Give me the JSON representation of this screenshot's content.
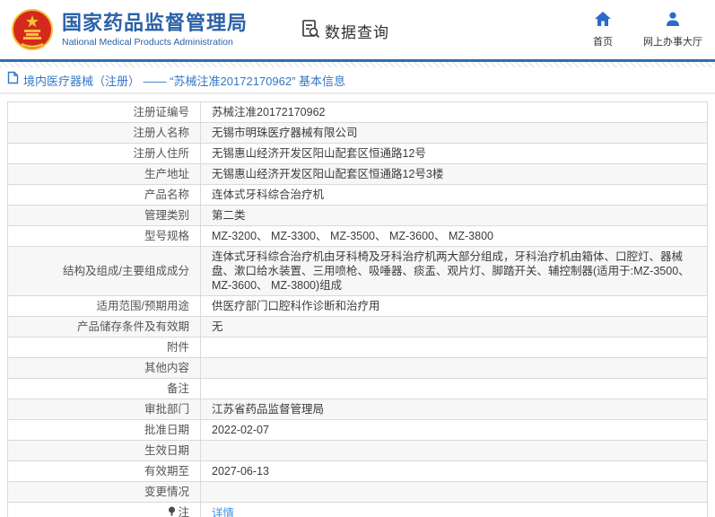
{
  "header": {
    "title": "国家药品监督管理局",
    "subtitle": "National Medical Products Administration",
    "section_label": "数据查询",
    "nav": [
      {
        "label": "首页",
        "icon": "home-icon"
      },
      {
        "label": "网上办事大厅",
        "icon": "user-icon"
      }
    ]
  },
  "breadcrumb": {
    "text": "境内医疗器械（注册） —— “苏械注准20172170962” 基本信息"
  },
  "table": {
    "rows": [
      {
        "label": "注册证编号",
        "value": "苏械注准20172170962"
      },
      {
        "label": "注册人名称",
        "value": "无锡市明珠医疗器械有限公司"
      },
      {
        "label": "注册人住所",
        "value": "无锡惠山经济开发区阳山配套区恒通路12号"
      },
      {
        "label": "生产地址",
        "value": "无锡惠山经济开发区阳山配套区恒通路12号3楼"
      },
      {
        "label": "产品名称",
        "value": "连体式牙科综合治疗机"
      },
      {
        "label": "管理类别",
        "value": "第二类"
      },
      {
        "label": "型号规格",
        "value": "MZ-3200、 MZ-3300、 MZ-3500、 MZ-3600、 MZ-3800"
      },
      {
        "label": "结构及组成/主要组成成分",
        "value": "连体式牙科综合治疗机由牙科椅及牙科治疗机两大部分组成，牙科治疗机由箱体、口腔灯、器械盘、漱口给水装置、三用喷枪、吸唾器、痰盂、观片灯、脚踏开关、辅控制器(适用于:MZ-3500、 MZ-3600、 MZ-3800)组成"
      },
      {
        "label": "适用范围/预期用途",
        "value": "供医疗部门口腔科作诊断和治疗用"
      },
      {
        "label": "产品储存条件及有效期",
        "value": "无"
      },
      {
        "label": "附件",
        "value": ""
      },
      {
        "label": "其他内容",
        "value": ""
      },
      {
        "label": "备注",
        "value": ""
      },
      {
        "label": "审批部门",
        "value": "江苏省药品监督管理局"
      },
      {
        "label": "批准日期",
        "value": "2022-02-07"
      },
      {
        "label": "生效日期",
        "value": ""
      },
      {
        "label": "有效期至",
        "value": "2027-06-13"
      },
      {
        "label": "变更情况",
        "value": ""
      },
      {
        "label": "注",
        "value": "详情",
        "link": true,
        "label_icon": "note-icon"
      }
    ]
  },
  "colors": {
    "brand_blue": "#2b61a8",
    "rule_blue": "#2e6db5",
    "nav_icon_blue": "#2a6bc8",
    "breadcrumb_blue": "#3377c6",
    "link_blue": "#3f8fdb",
    "row_alt_gray": "#f7f7f7",
    "table_border": "#d9d9d9",
    "emblem_red": "#d6291e",
    "emblem_gold": "#f2c23a"
  }
}
